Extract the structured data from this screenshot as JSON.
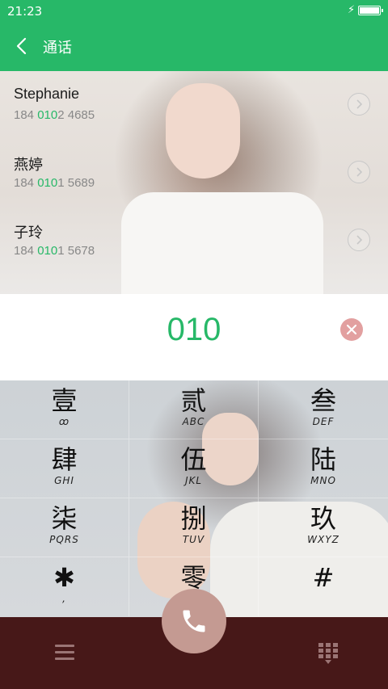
{
  "status_bar": {
    "time": "21:23",
    "charging_icon": "bolt-icon",
    "battery_icon": "battery-icon"
  },
  "header": {
    "title": "通话",
    "back_icon": "chevron-left-icon",
    "accent_color": "#27b868"
  },
  "contacts": [
    {
      "name": "Stephanie",
      "number_prefix": "184 ",
      "number_match": "010",
      "number_suffix": "2 4685"
    },
    {
      "name": "燕婷",
      "number_prefix": "184 ",
      "number_match": "010",
      "number_suffix": "1 5689"
    },
    {
      "name": "子玲",
      "number_prefix": "184 ",
      "number_match": "010",
      "number_suffix": "1 5678"
    }
  ],
  "dial_input": {
    "value": "010",
    "clear_icon": "close-icon"
  },
  "keypad": {
    "keys": [
      {
        "num": "壹",
        "letters": "ꝏ"
      },
      {
        "num": "贰",
        "letters": "ABC"
      },
      {
        "num": "叁",
        "letters": "DEF"
      },
      {
        "num": "肆",
        "letters": "GHI"
      },
      {
        "num": "伍",
        "letters": "JKL"
      },
      {
        "num": "陆",
        "letters": "MNO"
      },
      {
        "num": "柒",
        "letters": "PQRS"
      },
      {
        "num": "捌",
        "letters": "TUV"
      },
      {
        "num": "玖",
        "letters": "WXYZ"
      },
      {
        "num": "✱",
        "letters": ","
      },
      {
        "num": "零",
        "letters": "+"
      },
      {
        "num": "#",
        "letters": ""
      }
    ]
  },
  "bottom_bar": {
    "menu_icon": "menu-icon",
    "call_icon": "phone-icon",
    "dialpad_icon": "dialpad-icon",
    "bar_color": "#471818",
    "call_button_color": "#c49a92"
  }
}
